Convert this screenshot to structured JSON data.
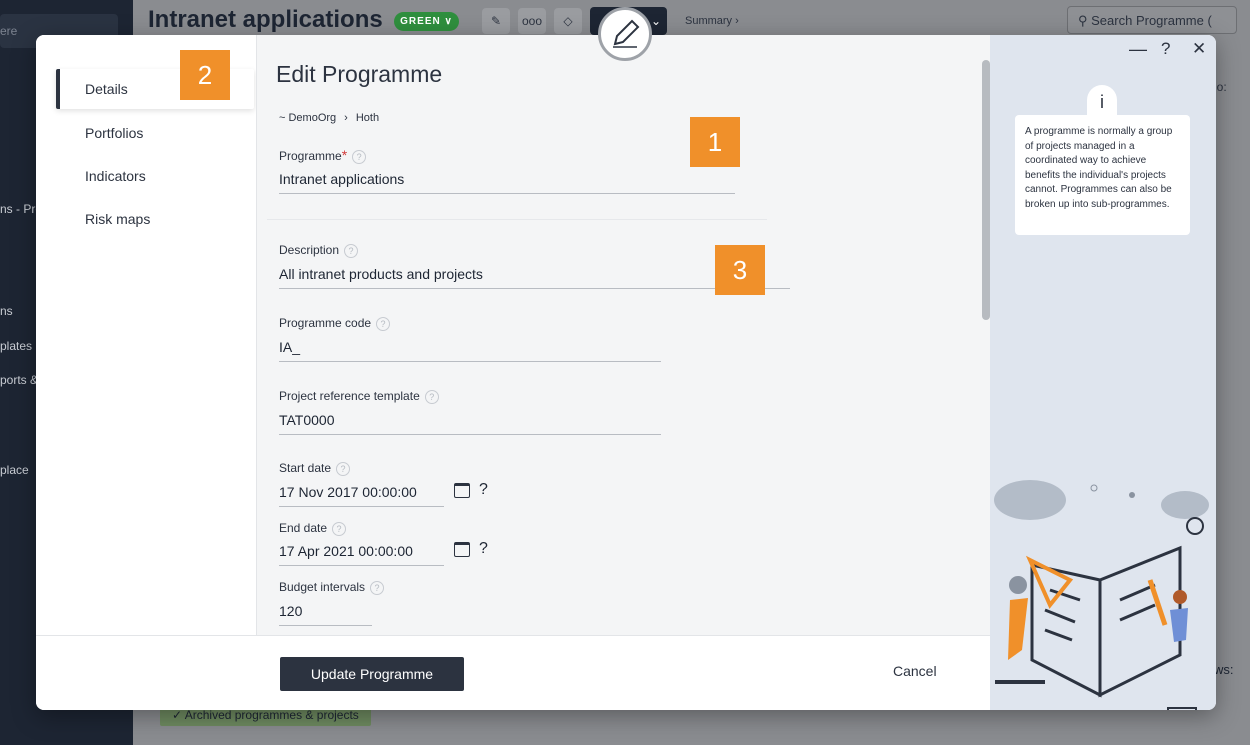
{
  "background": {
    "sidebar_items": [
      "ere",
      "ns - Pro",
      "ns",
      "plates",
      "ports &",
      "place"
    ],
    "title": "Intranet applications",
    "status_badge": "GREEN ∨",
    "toolbar_more": "ooo",
    "summary": "Summary ›",
    "search_placeholder": "Search Programme (",
    "col_fragment": "io:",
    "archived_label": "✓ Archived programmes & projects",
    "views_label": "ws:"
  },
  "modal": {
    "nav": {
      "items": [
        {
          "label": "Details"
        },
        {
          "label": "Portfolios"
        },
        {
          "label": "Indicators"
        },
        {
          "label": "Risk maps"
        }
      ]
    },
    "form": {
      "title": "Edit Programme",
      "breadcrumb": [
        "~ DemoOrg",
        "Hoth"
      ],
      "breadcrumb_sep": "›",
      "programme_label": "Programme",
      "programme_required": "*",
      "programme_value": "Intranet applications",
      "description_label": "Description",
      "description_value": "All intranet products and projects",
      "code_label": "Programme code",
      "code_value": "IA_",
      "template_label": "Project reference template",
      "template_value": "TAT0000",
      "start_label": "Start date",
      "start_value": "17 Nov 2017 00:00:00",
      "end_label": "End date",
      "end_value": "17 Apr 2021 00:00:00",
      "budget_label": "Budget intervals",
      "budget_value": "120",
      "help_glyph": "?"
    },
    "footer": {
      "update_label": "Update Programme",
      "cancel_label": "Cancel"
    },
    "help_panel": {
      "minimize": "—",
      "help": "?",
      "close": "✕",
      "info_icon": "i",
      "info_text": "A programme is normally a group of projects managed in a coordinated way to achieve benefits the individual's projects cannot. Programmes can also be broken up into sub-programmes."
    }
  },
  "markers": [
    "1",
    "2",
    "3"
  ],
  "colors": {
    "accent_orange": "#f0902a",
    "primary_dark": "#2c3340",
    "badge_green": "#2f8f3e",
    "required_red": "#d23b3b"
  }
}
